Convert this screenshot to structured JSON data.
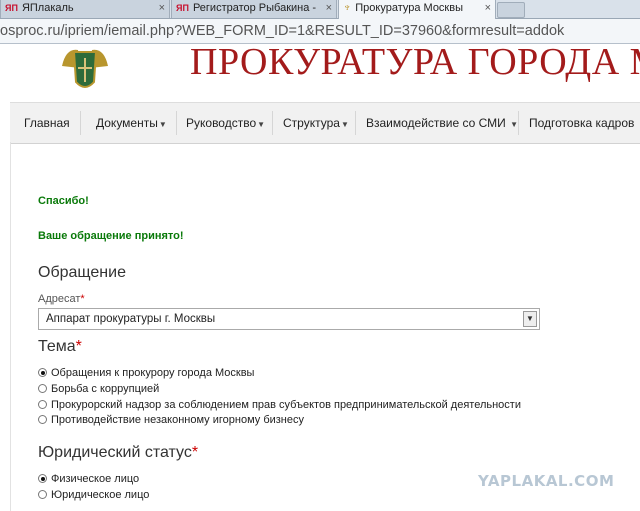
{
  "browser": {
    "tabs": [
      {
        "favicon": "ЯП",
        "title": "ЯПлакаль",
        "active": false
      },
      {
        "favicon": "ЯП",
        "title": "Регистратор Рыбакина -",
        "active": false
      },
      {
        "favicon": "eagle-icon",
        "title": "Прокуратура Москвы",
        "active": true
      }
    ],
    "close_glyph": "×",
    "url": "osproc.ru/ipriem/iemail.php?WEB_FORM_ID=1&RESULT_ID=37960&formresult=addok"
  },
  "site": {
    "title": "ПРОКУРАТУРА ГОРОДА МОСКВЫ",
    "nav": [
      {
        "label": "Главная",
        "dropdown": false
      },
      {
        "label": "Документы",
        "dropdown": true
      },
      {
        "label": "Руководство",
        "dropdown": true
      },
      {
        "label": "Структура",
        "dropdown": true
      },
      {
        "label": "Взаимодействие со СМИ",
        "dropdown": true
      },
      {
        "label": "Подготовка кадров",
        "dropdown": true
      }
    ],
    "caret_glyph": "▼"
  },
  "messages": {
    "thanks": "Спасибо!",
    "accepted": "Ваше обращение принято!"
  },
  "form": {
    "heading": "Обращение",
    "addressee": {
      "label": "Адресат",
      "required_mark": "*",
      "value": "Аппарат прокуратуры г. Москвы"
    },
    "topic": {
      "heading": "Тема",
      "required_mark": "*",
      "options": [
        {
          "label": "Обращения к прокурору города Москвы",
          "selected": true
        },
        {
          "label": "Борьба с коррупцией",
          "selected": false
        },
        {
          "label": "Прокурорский надзор за соблюдением прав субъектов предпринимательской деятельности",
          "selected": false
        },
        {
          "label": "Противодействие незаконному игорному бизнесу",
          "selected": false
        }
      ]
    },
    "legal_status": {
      "heading": "Юридический статус",
      "required_mark": "*",
      "options": [
        {
          "label": "Физическое лицо",
          "selected": true
        },
        {
          "label": "Юридическое лицо",
          "selected": false
        }
      ]
    }
  },
  "watermark": "YAPLAKAL.COM",
  "colors": {
    "title_red": "#a31b1b",
    "success_green": "#0a7a0a"
  }
}
